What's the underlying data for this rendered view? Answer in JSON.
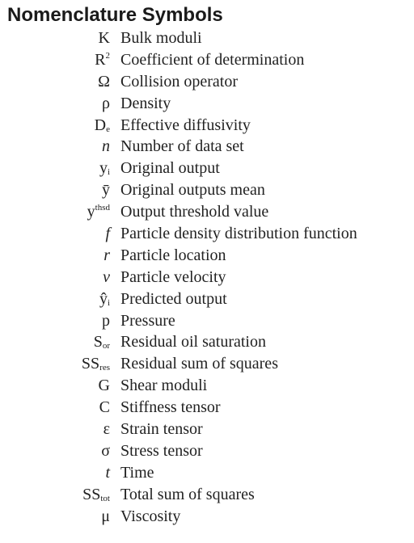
{
  "title": "Nomenclature Symbols",
  "entries": [
    {
      "base": "K",
      "sup": "",
      "sub": "",
      "italic": false,
      "desc": "Bulk moduli"
    },
    {
      "base": "R",
      "sup": "2",
      "sub": "",
      "italic": false,
      "desc": "Coefficient of determination"
    },
    {
      "base": "Ω",
      "sup": "",
      "sub": "",
      "italic": false,
      "desc": "Collision operator"
    },
    {
      "base": "ρ",
      "sup": "",
      "sub": "",
      "italic": false,
      "desc": "Density"
    },
    {
      "base": "D",
      "sup": "",
      "sub": "e",
      "italic": false,
      "desc": "Effective diffusivity"
    },
    {
      "base": "n",
      "sup": "",
      "sub": "",
      "italic": true,
      "desc": "Number of data set"
    },
    {
      "base": "y",
      "sup": "",
      "sub": "i",
      "italic": false,
      "desc": "Original output"
    },
    {
      "base": "ȳ",
      "sup": "",
      "sub": "",
      "italic": false,
      "desc": "Original outputs mean"
    },
    {
      "base": "y",
      "sup": "thsd",
      "sub": "",
      "italic": false,
      "desc": "Output threshold value"
    },
    {
      "base": "f",
      "sup": "",
      "sub": "",
      "italic": true,
      "desc": "Particle density distribution function"
    },
    {
      "base": "r",
      "sup": "",
      "sub": "",
      "italic": true,
      "desc": "Particle location"
    },
    {
      "base": "v",
      "sup": "",
      "sub": "",
      "italic": true,
      "desc": "Particle velocity"
    },
    {
      "base": "ŷ",
      "sup": "",
      "sub": "i",
      "italic": false,
      "desc": "Predicted output"
    },
    {
      "base": "p",
      "sup": "",
      "sub": "",
      "italic": false,
      "desc": "Pressure"
    },
    {
      "base": "S",
      "sup": "",
      "sub": "or",
      "italic": false,
      "desc": "Residual oil saturation"
    },
    {
      "base": "SS",
      "sup": "",
      "sub": "res",
      "italic": false,
      "desc": "Residual sum of squares"
    },
    {
      "base": "G",
      "sup": "",
      "sub": "",
      "italic": false,
      "desc": "Shear moduli"
    },
    {
      "base": "C",
      "sup": "",
      "sub": "",
      "italic": false,
      "desc": "Stiffness tensor"
    },
    {
      "base": "ε",
      "sup": "",
      "sub": "",
      "italic": false,
      "desc": "Strain tensor"
    },
    {
      "base": "σ",
      "sup": "",
      "sub": "",
      "italic": false,
      "desc": "Stress tensor"
    },
    {
      "base": "t",
      "sup": "",
      "sub": "",
      "italic": true,
      "desc": "Time"
    },
    {
      "base": "SS",
      "sup": "",
      "sub": "tot",
      "italic": false,
      "desc": "Total sum of squares"
    },
    {
      "base": "μ",
      "sup": "",
      "sub": "",
      "italic": false,
      "desc": "Viscosity"
    }
  ]
}
